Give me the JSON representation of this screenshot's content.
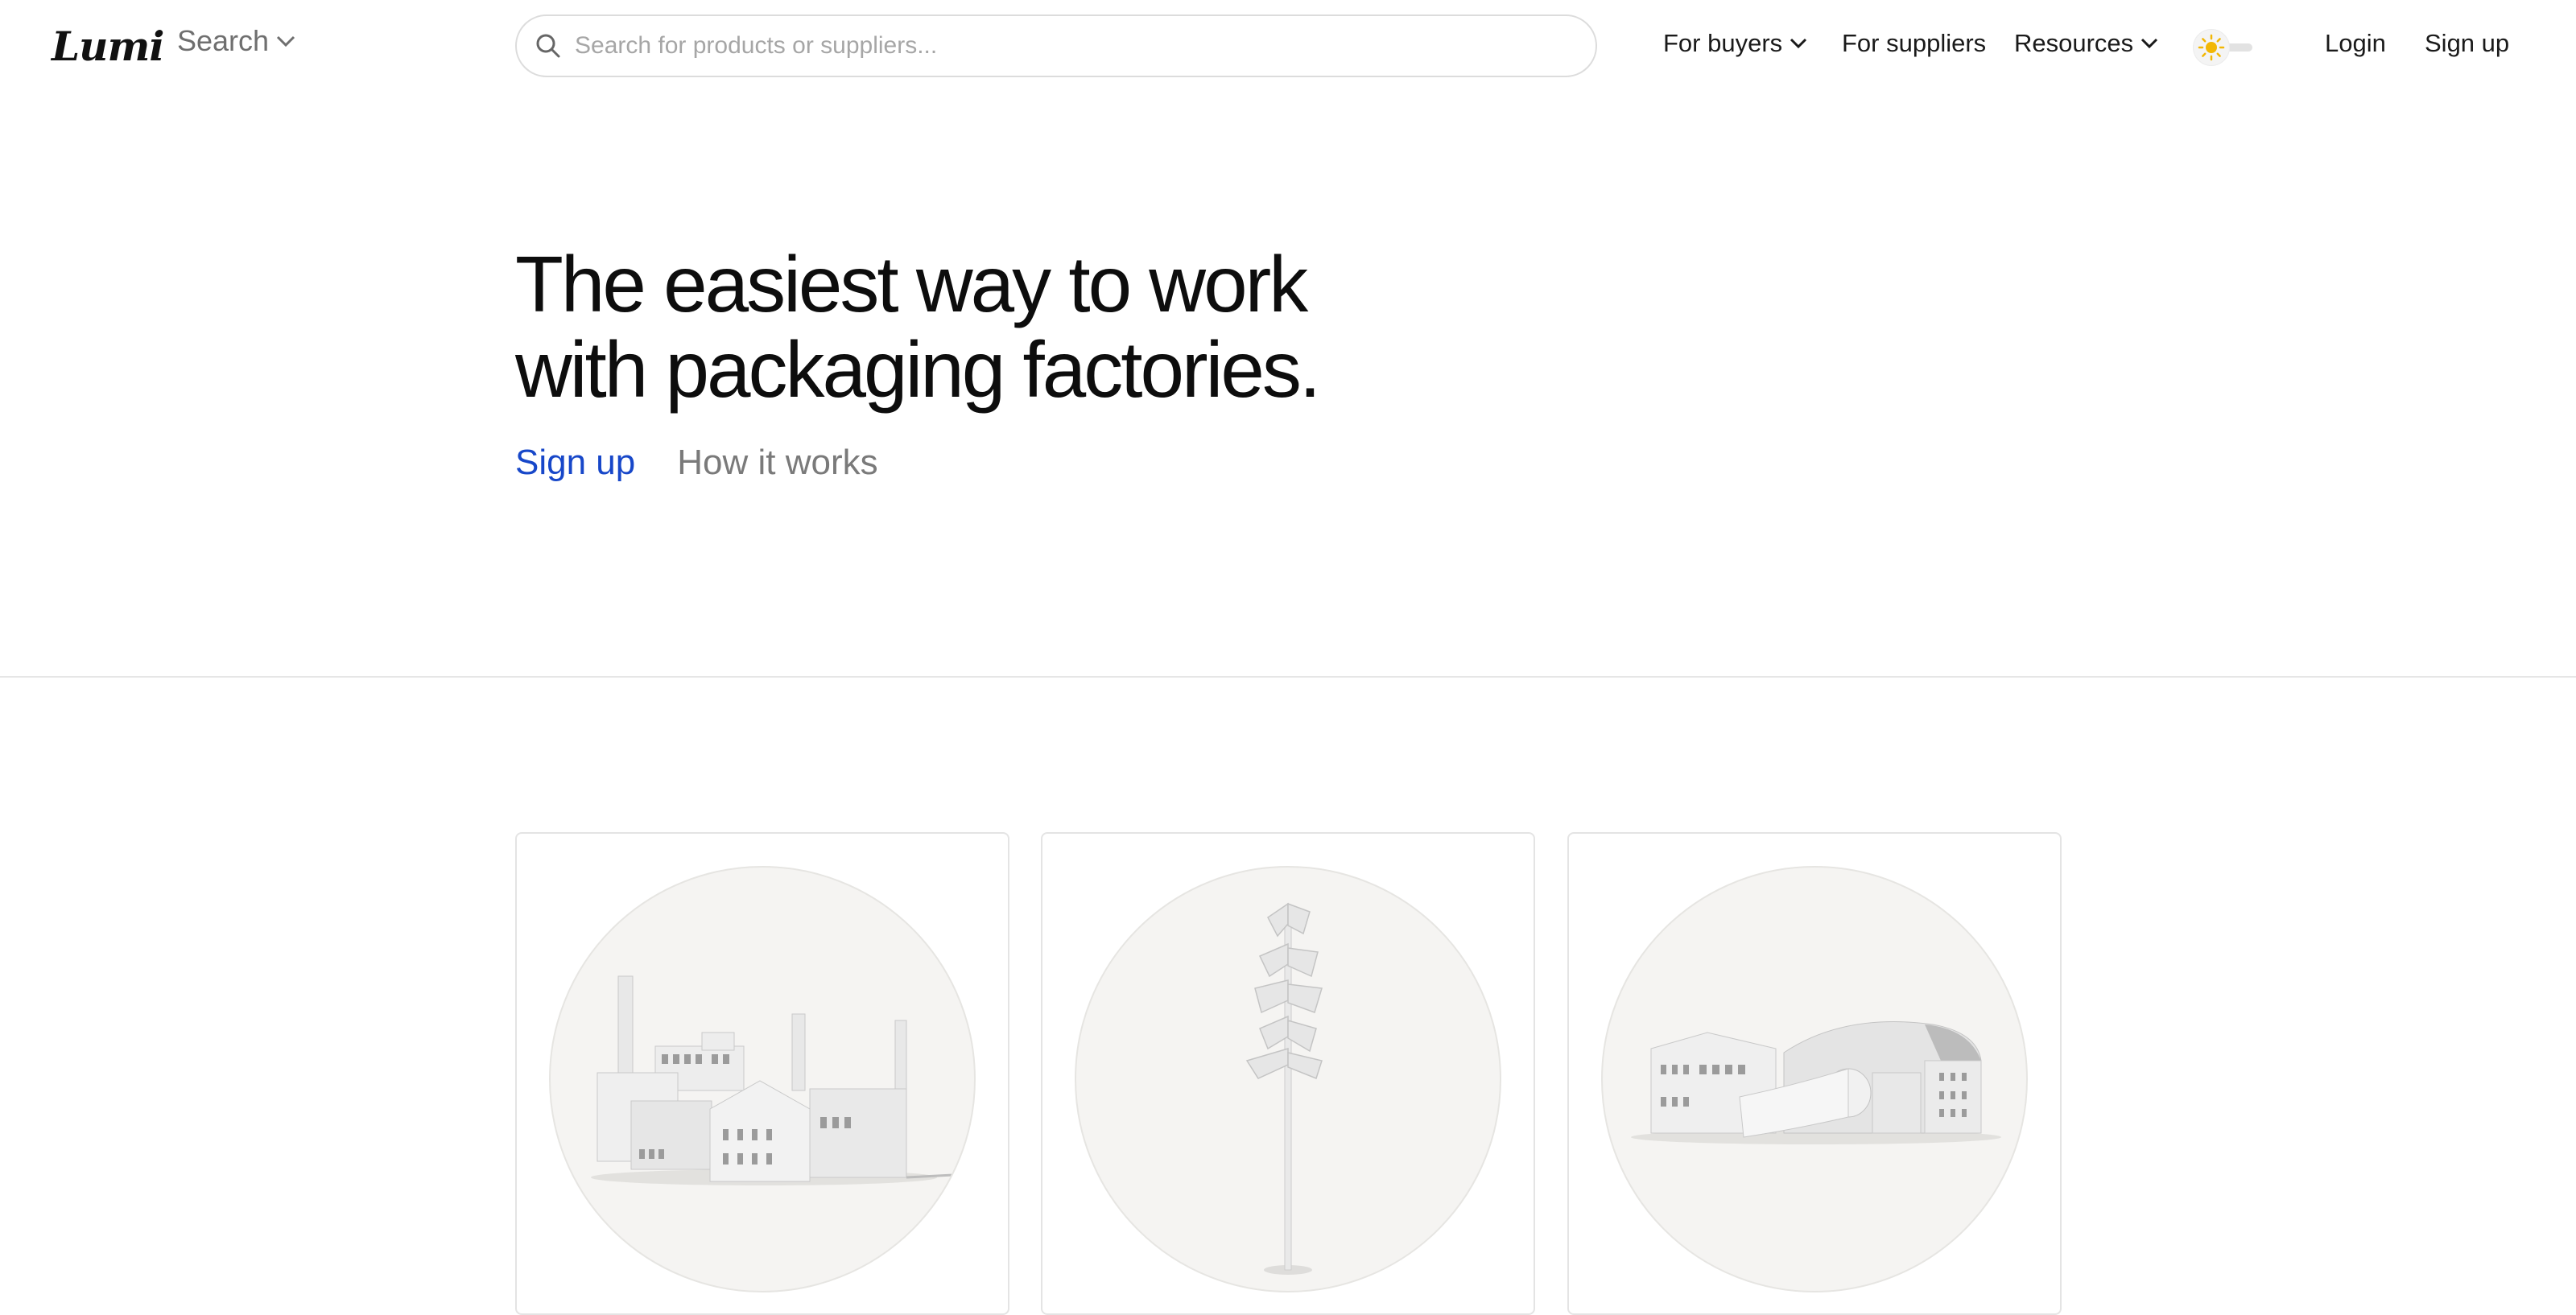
{
  "header": {
    "logo": "Lumi",
    "search_menu_label": "Search",
    "search_placeholder": "Search for products or suppliers...",
    "nav": {
      "for_buyers": "For buyers",
      "for_suppliers": "For suppliers",
      "resources": "Resources",
      "login": "Login",
      "signup": "Sign up"
    },
    "theme": "light"
  },
  "hero": {
    "title_line1": "The easiest way to work",
    "title_line2": "with packaging factories.",
    "signup_link": "Sign up",
    "how_link": "How it works"
  },
  "cards": [
    {
      "illustration": "factory-illustration"
    },
    {
      "illustration": "tree-illustration"
    },
    {
      "illustration": "paper-mill-illustration"
    }
  ],
  "colors": {
    "accent": "#1747c9",
    "muted_text": "#7a7a7a",
    "border": "#e4e4e4",
    "card_circle": "#f5f4f2",
    "sun": "#f2b705"
  }
}
